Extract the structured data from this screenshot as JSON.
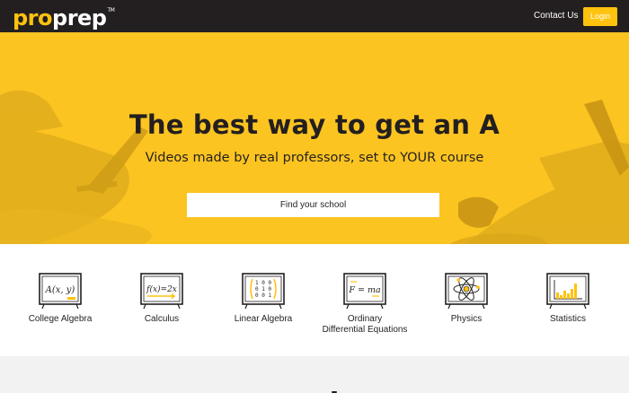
{
  "header": {
    "logo_pro": "pro",
    "logo_prep": "prep",
    "logo_tm": "TM",
    "contact_label": "Contact Us",
    "login_label": "Login"
  },
  "hero": {
    "headline": "The best way to get an A",
    "subhead": "Videos made by real professors, set to YOUR course",
    "search_label": "Find your school"
  },
  "courses": [
    {
      "label": "College Algebra",
      "icon": "algebra-board-icon",
      "formula": "A(x, y)"
    },
    {
      "label": "Calculus",
      "icon": "calculus-board-icon",
      "formula": "f(x)=2x"
    },
    {
      "label": "Linear Algebra",
      "icon": "matrix-board-icon",
      "formula": "1 0 0 / 0 1 0 / 0 0 1"
    },
    {
      "label": "Ordinary Differential Equations",
      "label_line1": "Ordinary",
      "label_line2": "Differential Equations",
      "icon": "ode-board-icon",
      "formula": "F = ma"
    },
    {
      "label": "Physics",
      "icon": "atom-board-icon"
    },
    {
      "label": "Statistics",
      "icon": "bar-chart-board-icon"
    }
  ],
  "colors": {
    "brand_yellow": "#fcc421",
    "accent_yellow": "#ffc20e",
    "dark": "#231f20"
  }
}
